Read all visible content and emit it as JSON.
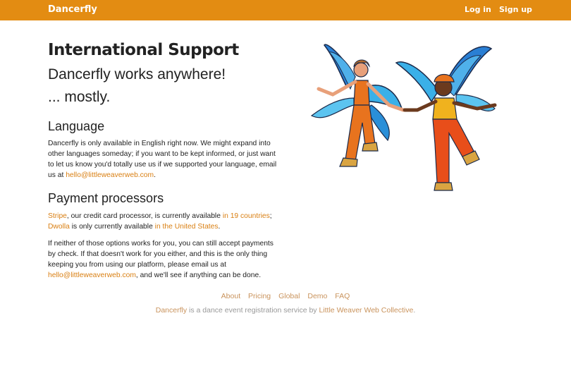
{
  "colors": {
    "brand": "#e38c12",
    "link": "#d97f12",
    "footer_link": "#c9935c",
    "footer_text": "#999999"
  },
  "navbar": {
    "brand": "Dancerfly",
    "login": "Log in",
    "signup": "Sign up"
  },
  "main": {
    "title": "International Support",
    "lead": "Dancerfly works anywhere!",
    "lead2": "... mostly.",
    "language": {
      "heading": "Language",
      "text_1": "Dancerfly is only available in English right now. We might expand into other languages someday; if you want to be kept informed, or just want to let us know you'd totally use us if we supported your language, email us at ",
      "email": "hello@littleweaverweb.com",
      "text_2": "."
    },
    "payment": {
      "heading": "Payment processors",
      "stripe": "Stripe",
      "stripe_text": ", our credit card processor, is currently available ",
      "stripe_countries": "in 19 countries",
      "stripe_end": ";",
      "dwolla": "Dwolla",
      "dwolla_text": " is only currently available ",
      "dwolla_where": "in the United States",
      "dwolla_end": ".",
      "fallback_text": "If neither of those options works for you, you can still accept payments by check. If that doesn't work for you either, and this is the only thing keeping you from using our platform, please email us at ",
      "email": "hello@littleweaverweb.com",
      "fallback_end": ", and we'll see if anything can be done."
    }
  },
  "illustration": {
    "icon": "winged-dancers-illustration"
  },
  "footer": {
    "links": [
      "About",
      "Pricing",
      "Global",
      "Demo",
      "FAQ"
    ],
    "note_brand": "Dancerfly",
    "note_text": " is a dance event registration service by ",
    "note_org": "Little Weaver Web Collective",
    "note_end": "."
  }
}
